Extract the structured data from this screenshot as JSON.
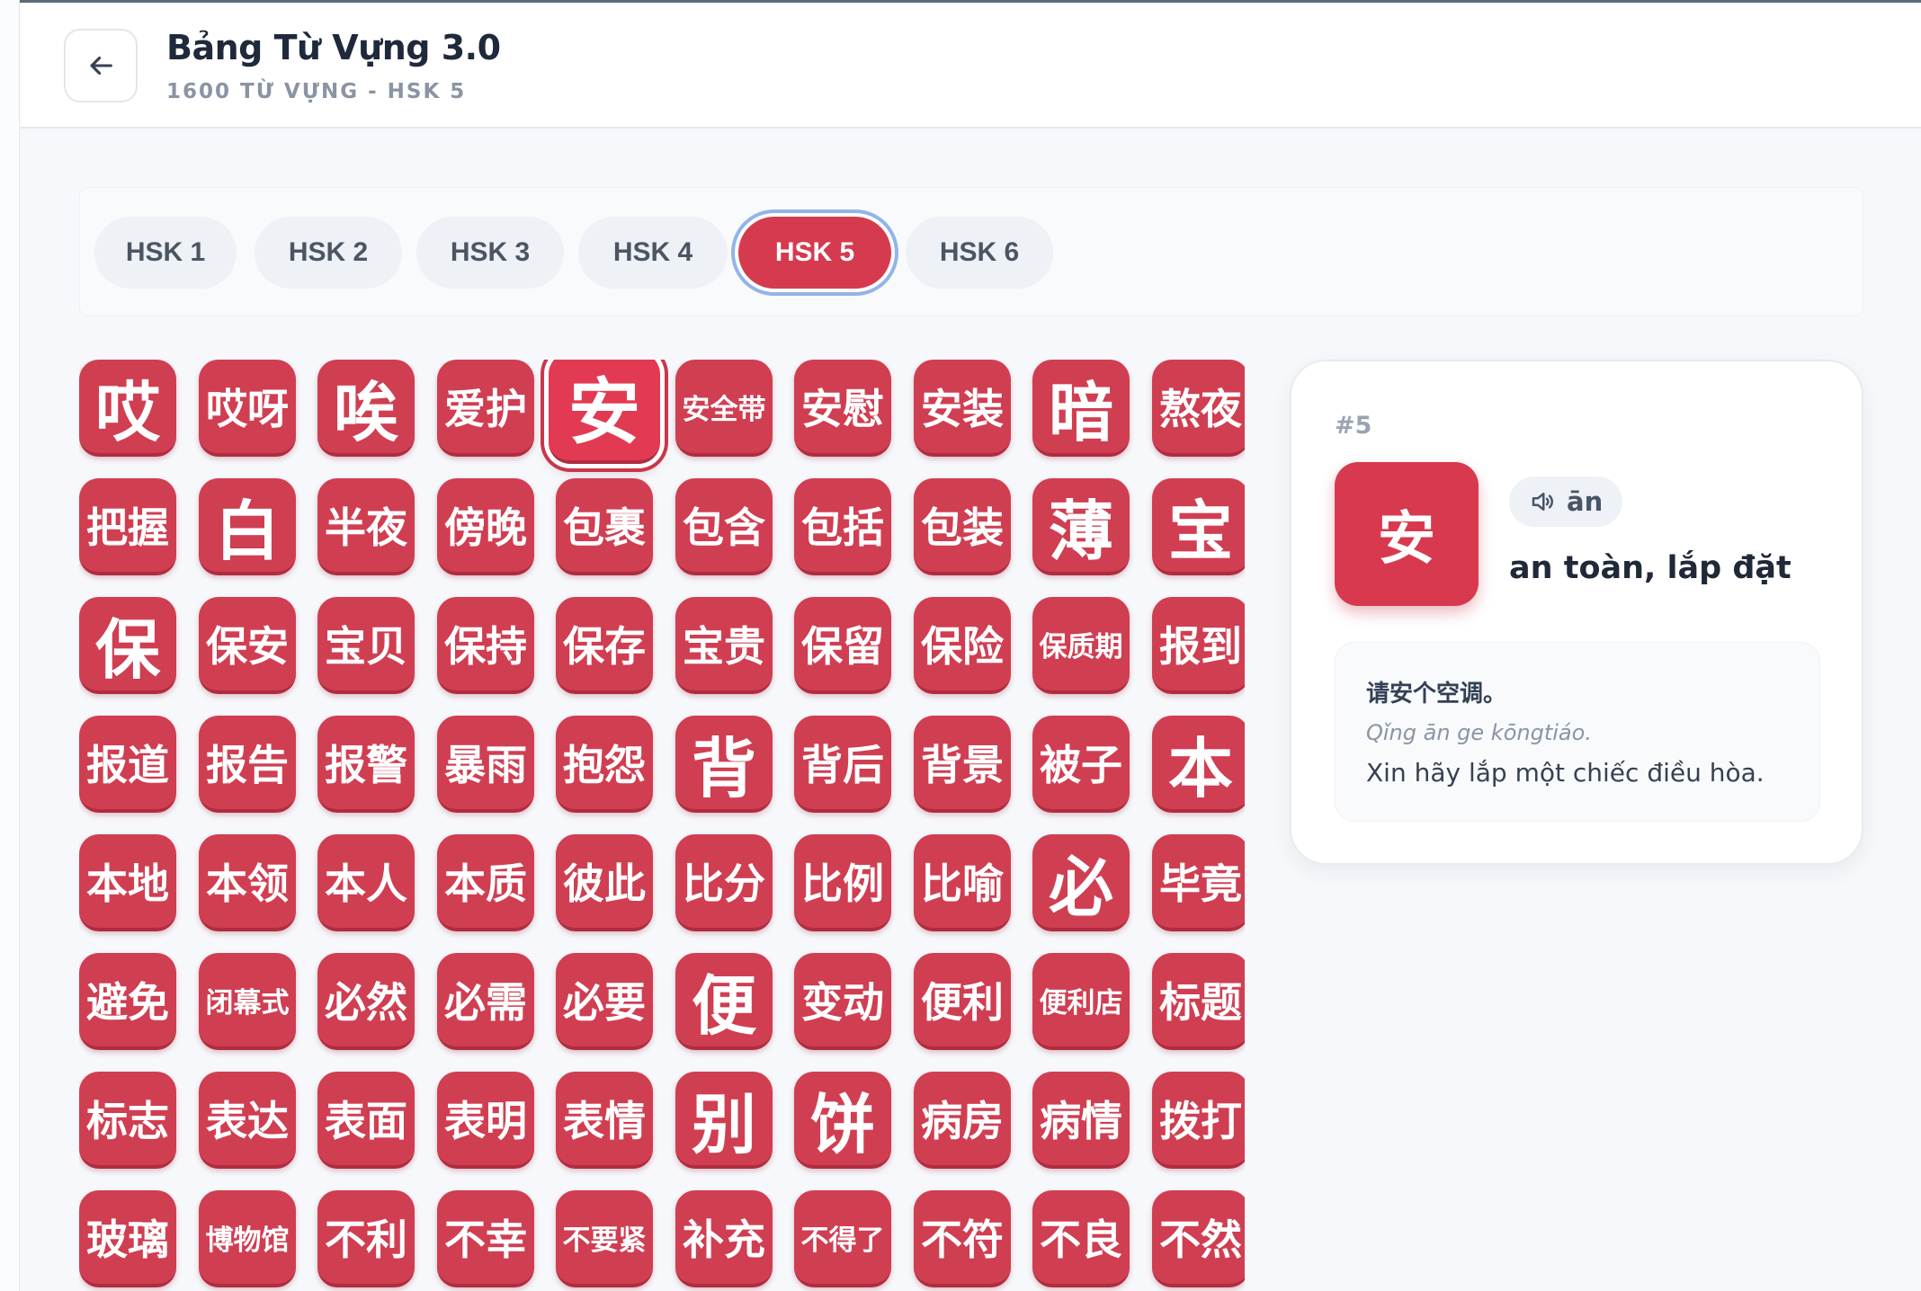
{
  "header": {
    "title": "Bảng Từ Vựng 3.0",
    "subtitle": "1600 TỪ VỰNG - HSK 5"
  },
  "tabs": [
    {
      "label": "HSK 1",
      "active": false
    },
    {
      "label": "HSK 2",
      "active": false
    },
    {
      "label": "HSK 3",
      "active": false
    },
    {
      "label": "HSK 4",
      "active": false
    },
    {
      "label": "HSK 5",
      "active": true
    },
    {
      "label": "HSK 6",
      "active": false
    }
  ],
  "selected_index": 4,
  "words": [
    "哎",
    "哎呀",
    "唉",
    "爱护",
    "安",
    "安全带",
    "安慰",
    "安装",
    "暗",
    "熬夜",
    "把握",
    "白",
    "半夜",
    "傍晚",
    "包裹",
    "包含",
    "包括",
    "包装",
    "薄",
    "宝",
    "保",
    "保安",
    "宝贝",
    "保持",
    "保存",
    "宝贵",
    "保留",
    "保险",
    "保质期",
    "报到",
    "报道",
    "报告",
    "报警",
    "暴雨",
    "抱怨",
    "背",
    "背后",
    "背景",
    "被子",
    "本",
    "本地",
    "本领",
    "本人",
    "本质",
    "彼此",
    "比分",
    "比例",
    "比喻",
    "必",
    "毕竟",
    "避免",
    "闭幕式",
    "必然",
    "必需",
    "必要",
    "便",
    "变动",
    "便利",
    "便利店",
    "标题",
    "标志",
    "表达",
    "表面",
    "表明",
    "表情",
    "别",
    "饼",
    "病房",
    "病情",
    "拨打",
    "玻璃",
    "博物馆",
    "不利",
    "不幸",
    "不要紧",
    "补充",
    "不得了",
    "不符",
    "不良",
    "不然"
  ],
  "detail": {
    "index": "#5",
    "hanzi": "安",
    "pinyin": "ān",
    "meaning": "an toàn, lắp đặt",
    "example": {
      "zh": "请安个空调。",
      "pinyin": "Qǐng ān ge kōngtiáo.",
      "vi": "Xin hãy lắp một chiếc điều hòa."
    }
  },
  "icons": {
    "back": "arrow-left-icon",
    "audio": "speaker-icon"
  },
  "colors": {
    "accent": "#d03e52",
    "accent_dark": "#b02c3f",
    "focus_ring": "#93b4e8"
  }
}
